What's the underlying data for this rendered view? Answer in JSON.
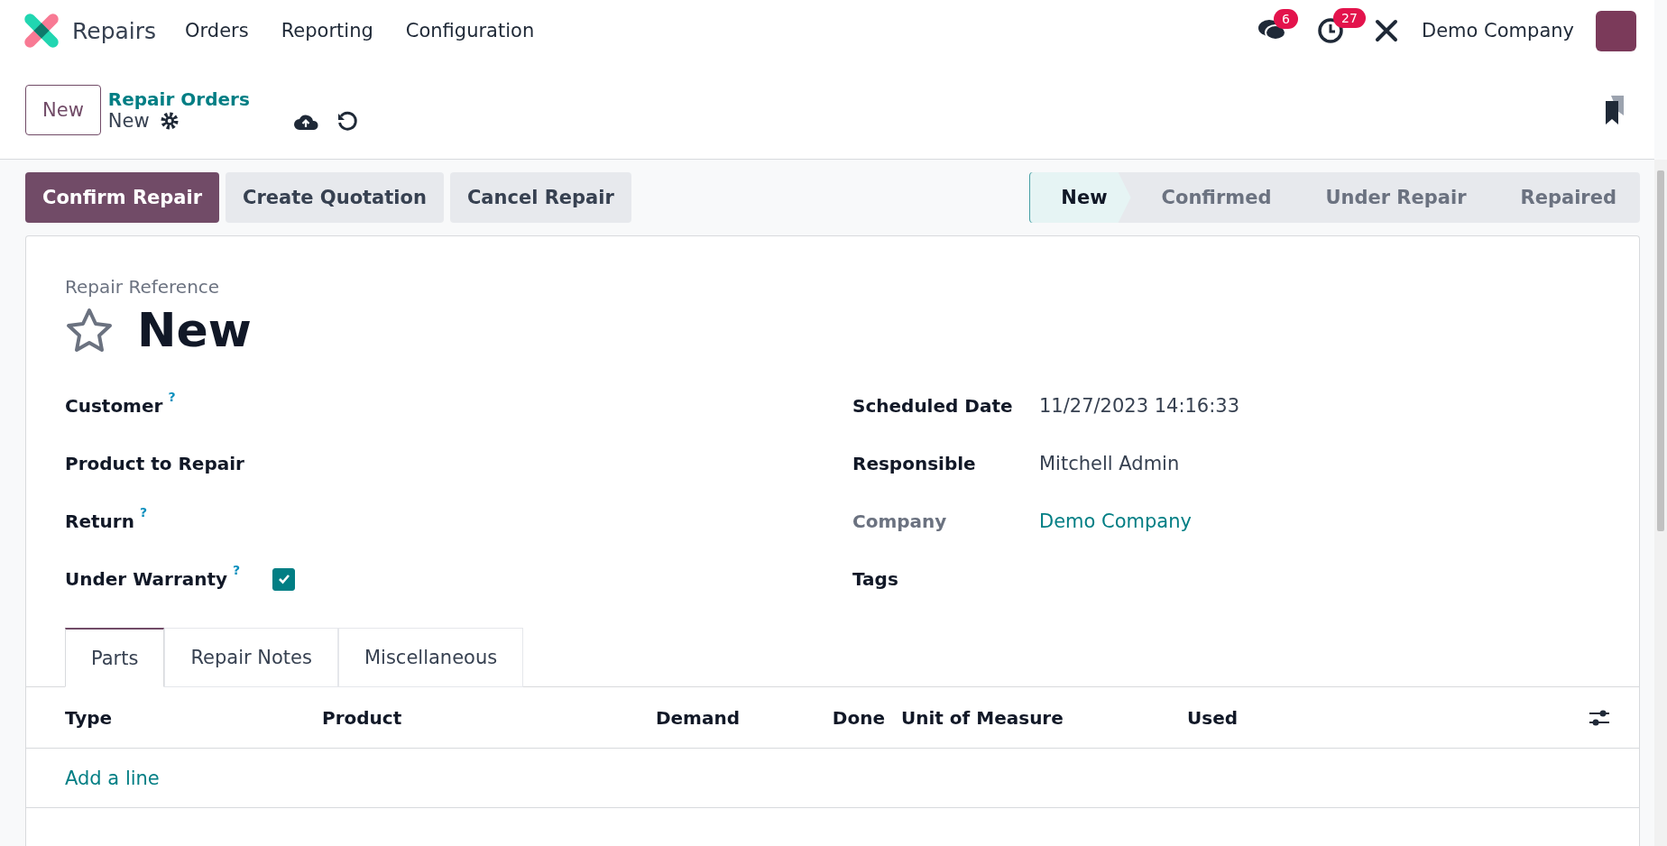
{
  "navbar": {
    "app_name": "Repairs",
    "menu": [
      "Orders",
      "Reporting",
      "Configuration"
    ],
    "messages_badge": "6",
    "activities_badge": "27",
    "company": "Demo Company"
  },
  "control_panel": {
    "new_button": "New",
    "breadcrumb": "Repair Orders",
    "record": "New"
  },
  "actions": [
    {
      "label": "Confirm Repair",
      "kind": "primary"
    },
    {
      "label": "Create Quotation",
      "kind": "secondary"
    },
    {
      "label": "Cancel Repair",
      "kind": "secondary"
    }
  ],
  "statusbar": [
    {
      "label": "New",
      "selected": true
    },
    {
      "label": "Confirmed",
      "selected": false
    },
    {
      "label": "Under Repair",
      "selected": false
    },
    {
      "label": "Repaired",
      "selected": false
    }
  ],
  "form": {
    "reference_label": "Repair Reference",
    "title": "New",
    "starred": false,
    "left_fields": [
      {
        "label": "Customer",
        "help": "?",
        "kind": "text"
      },
      {
        "label": "Product to Repair",
        "kind": "text"
      },
      {
        "label": "Return",
        "help": "?",
        "kind": "text"
      },
      {
        "label": "Under Warranty",
        "help": "?",
        "kind": "checkbox",
        "checked": true
      }
    ],
    "right_fields": [
      {
        "label": "Scheduled Date",
        "value": "11/27/2023 14:16:33",
        "kind": "text"
      },
      {
        "label": "Responsible",
        "value": "Mitchell Admin",
        "kind": "text"
      },
      {
        "label": "Company",
        "value": "Demo Company",
        "kind": "link",
        "muted": true
      },
      {
        "label": "Tags"
      }
    ]
  },
  "tabs": [
    {
      "label": "Parts",
      "selected": true
    },
    {
      "label": "Repair Notes",
      "selected": false
    },
    {
      "label": "Miscellaneous",
      "selected": false
    }
  ],
  "table": {
    "columns": [
      "Type",
      "Product",
      "Demand",
      "Done",
      "Unit of Measure",
      "Used"
    ],
    "add_line": "Add a line"
  }
}
